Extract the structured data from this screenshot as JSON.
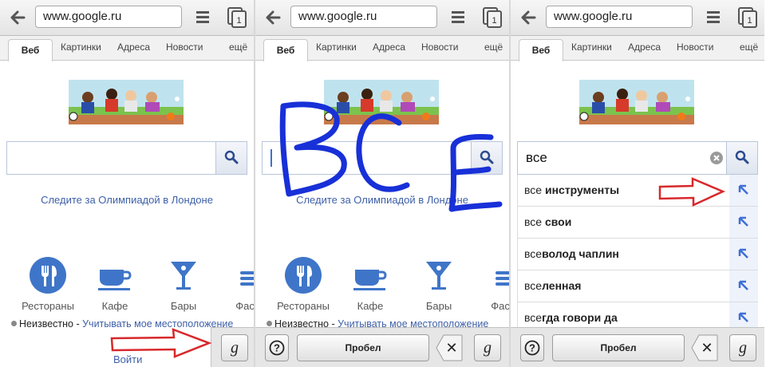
{
  "browser": {
    "url": "www.google.ru",
    "tab_count": "1",
    "nav_tabs": [
      "Веб",
      "Картинки",
      "Адреса",
      "Новости",
      "ещё"
    ]
  },
  "page": {
    "search_value_typed": "все",
    "olympics_link": "Следите за Олимпиадой в Лондоне",
    "categories": [
      "Рестораны",
      "Кафе",
      "Бары",
      "Фаст"
    ],
    "location_status": "Неизвестно -",
    "location_link": "Учитывать мое местоположение",
    "login_link": "Войти"
  },
  "handwriting": {
    "text": "ВСЕ",
    "keyboard": {
      "help": "?",
      "space": "Пробел",
      "delete": "✕",
      "handwriting": "g"
    }
  },
  "suggestions": [
    {
      "prefix": "все",
      "suffix": " инструменты"
    },
    {
      "prefix": "все",
      "suffix": " свои"
    },
    {
      "prefix": "все",
      "suffix": "волод чаплин"
    },
    {
      "prefix": "все",
      "suffix": "ленная"
    },
    {
      "prefix": "все",
      "suffix": "гда говори да"
    }
  ],
  "colors": {
    "link": "#3d5fa8",
    "icon_blue": "#3f75c8",
    "ink": "#1830d8",
    "annotation_arrow": "#d8282b"
  }
}
